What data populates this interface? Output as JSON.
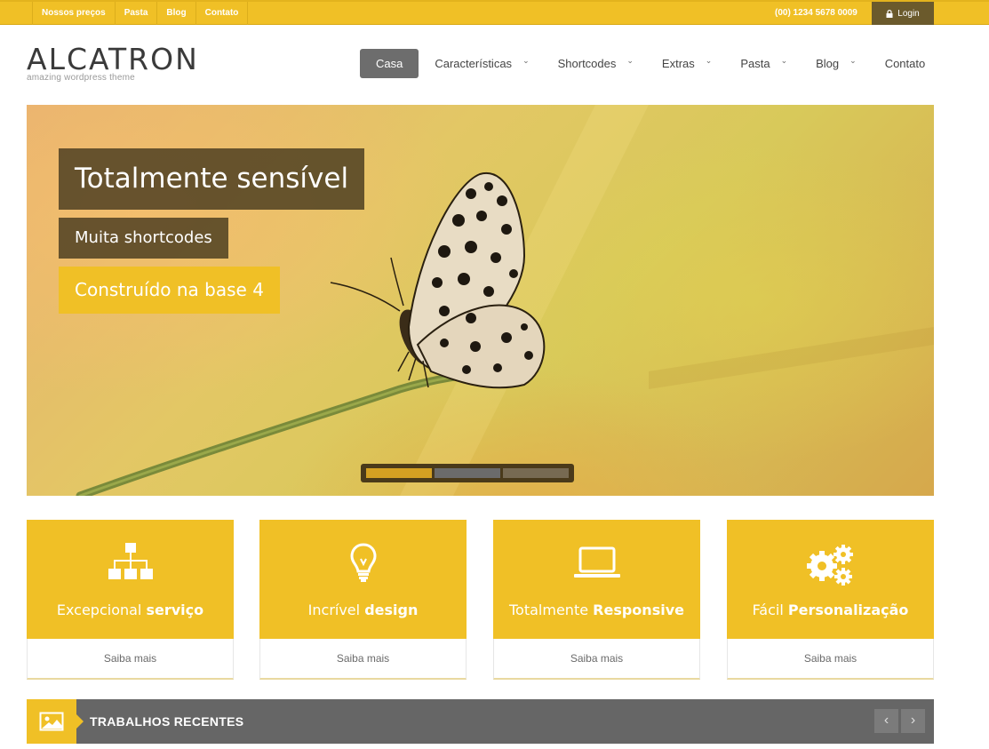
{
  "topbar": {
    "links": [
      "Nossos preços",
      "Pasta",
      "Blog",
      "Contato"
    ],
    "phone": "(00) 1234 5678 0009",
    "login_label": "Login"
  },
  "logo": {
    "title": "ALCATRON",
    "tagline": "amazing wordpress theme"
  },
  "nav": {
    "items": [
      {
        "label": "Casa",
        "active": true,
        "dropdown": false
      },
      {
        "label": "Características",
        "active": false,
        "dropdown": true
      },
      {
        "label": "Shortcodes",
        "active": false,
        "dropdown": true
      },
      {
        "label": "Extras",
        "active": false,
        "dropdown": true
      },
      {
        "label": "Pasta",
        "active": false,
        "dropdown": true
      },
      {
        "label": "Blog",
        "active": false,
        "dropdown": true
      },
      {
        "label": "Contato",
        "active": false,
        "dropdown": false
      }
    ]
  },
  "slider": {
    "caption_1": "Totalmente sensível",
    "caption_2": "Muita shortcodes",
    "caption_3": "Construído na base 4",
    "bullets": 3,
    "active_bullet": 1
  },
  "features": [
    {
      "icon": "sitemap-icon",
      "title_light": "Excepcional",
      "title_bold": "serviço",
      "more": "Saiba mais"
    },
    {
      "icon": "lightbulb-icon",
      "title_light": "Incrível",
      "title_bold": "design",
      "more": "Saiba mais"
    },
    {
      "icon": "laptop-icon",
      "title_light": "Totalmente",
      "title_bold": "Responsive",
      "more": "Saiba mais"
    },
    {
      "icon": "gears-icon",
      "title_light": "Fácil",
      "title_bold": "Personalização",
      "more": "Saiba mais"
    }
  ],
  "recent_works": {
    "title": "TRABALHOS RECENTES",
    "icon": "image-icon"
  },
  "colors": {
    "accent": "#f0c026",
    "dark": "#666666",
    "nav_active": "#6d6d6d"
  }
}
